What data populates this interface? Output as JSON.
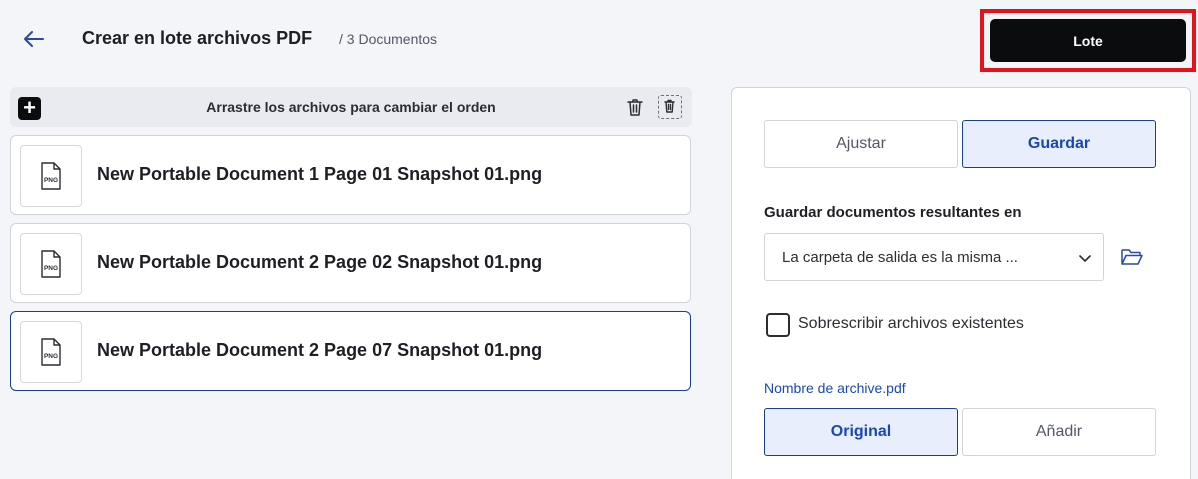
{
  "header": {
    "title": "Crear en lote archivos PDF",
    "subtitle": "/ 3 Documentos",
    "primary_button": "Lote"
  },
  "toolbar": {
    "hint": "Arrastre los archivos para cambiar el orden",
    "add_icon": "plus-icon",
    "delete_icon": "trash-icon",
    "delete_all_icon": "trash-all-icon"
  },
  "files": [
    {
      "name": "New Portable Document 1 Page 01 Snapshot 01.png",
      "type": "PNG",
      "selected": false
    },
    {
      "name": "New Portable Document 2 Page 02 Snapshot 01.png",
      "type": "PNG",
      "selected": false
    },
    {
      "name": "New Portable Document 2 Page 07 Snapshot 01.png",
      "type": "PNG",
      "selected": true
    }
  ],
  "settings": {
    "mode_tabs": [
      {
        "label": "Ajustar",
        "active": false
      },
      {
        "label": "Guardar",
        "active": true
      }
    ],
    "output_label": "Guardar documentos resultantes en",
    "output_value": "La carpeta de salida es la misma ...",
    "overwrite_label": "Sobrescribir archivos existentes",
    "overwrite_checked": false,
    "filename_link": "Nombre de archive.pdf",
    "name_tabs": [
      {
        "label": "Original",
        "active": true
      },
      {
        "label": "Añadir",
        "active": false
      }
    ]
  },
  "colors": {
    "accent": "#1a47b8",
    "primary_button_bg": "#0b0c0e",
    "highlight_border": "#e4121b"
  }
}
